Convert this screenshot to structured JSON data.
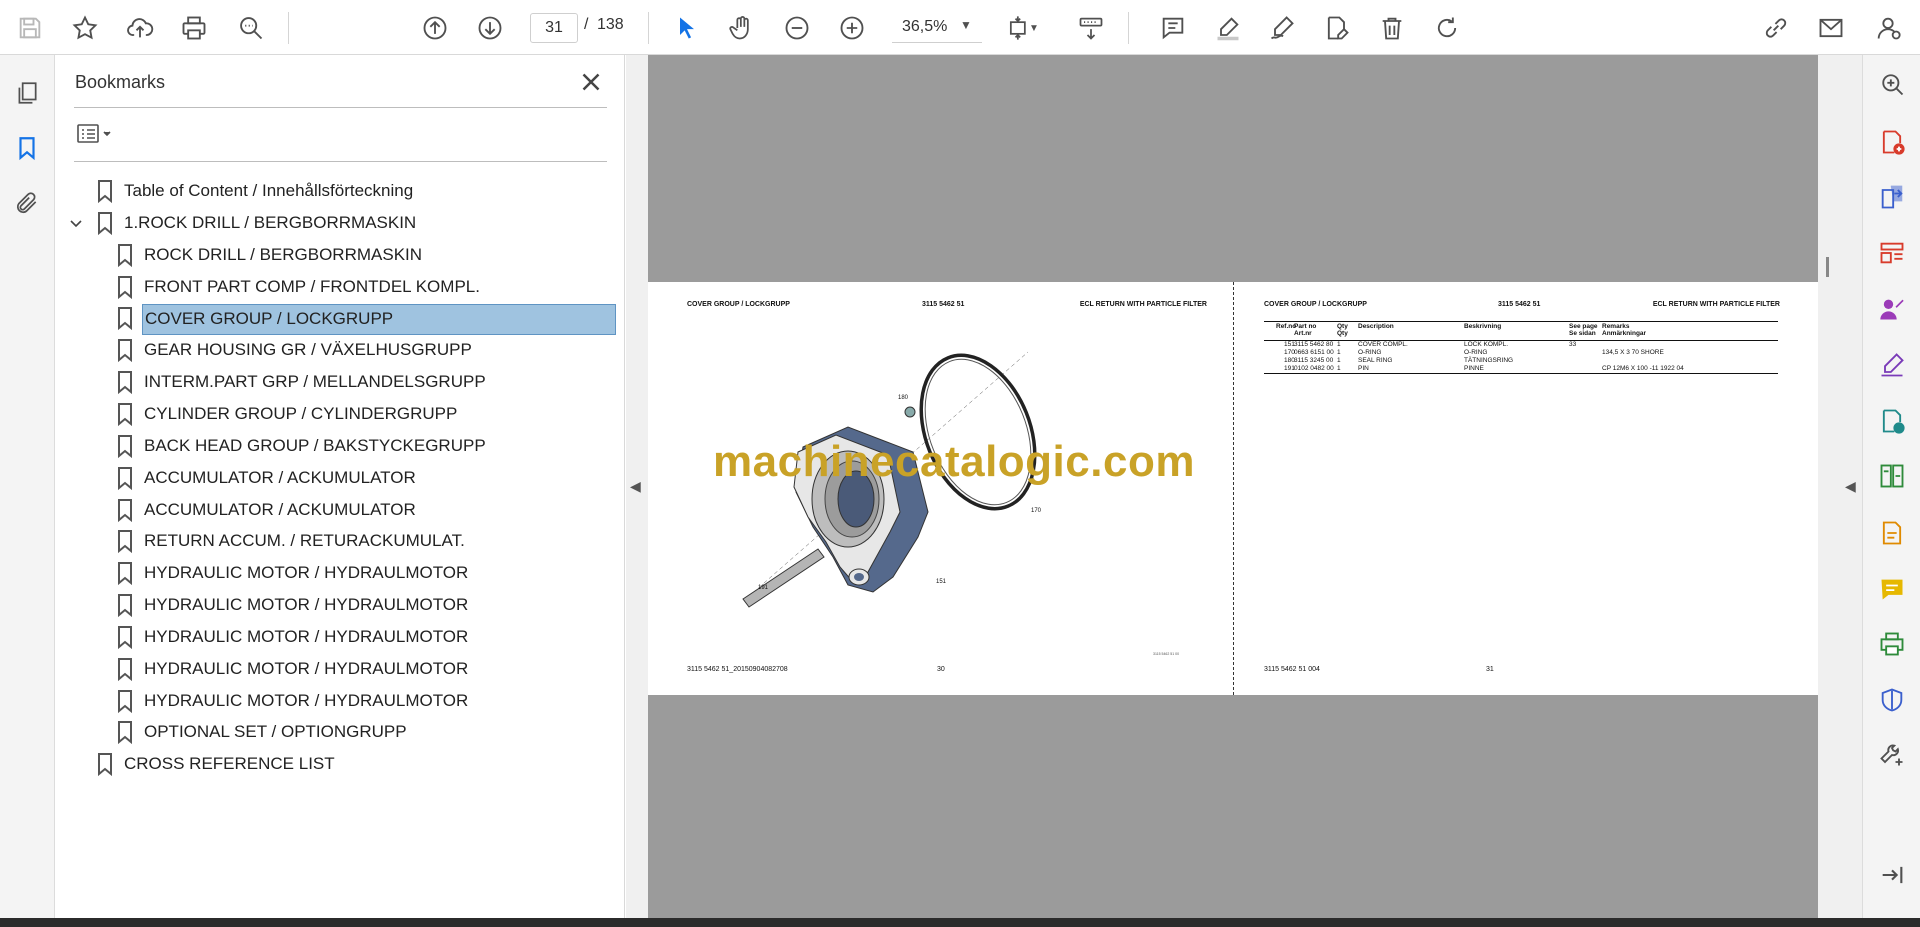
{
  "toolbar": {
    "current_page": "31",
    "page_separator": "/",
    "total_pages": "138",
    "zoom": "36,5%"
  },
  "bookmarks_panel": {
    "title": "Bookmarks",
    "items": [
      {
        "label": "Table of Content / Innehållsförteckning",
        "level": 0,
        "selected": false
      },
      {
        "label": "1.ROCK DRILL / BERGBORRMASKIN",
        "level": 0,
        "expanded": true,
        "selected": false
      },
      {
        "label": "ROCK DRILL / BERGBORRMASKIN",
        "level": 1,
        "selected": false
      },
      {
        "label": "FRONT PART COMP / FRONTDEL KOMPL.",
        "level": 1,
        "selected": false
      },
      {
        "label": "COVER GROUP / LOCKGRUPP",
        "level": 1,
        "selected": true
      },
      {
        "label": "GEAR HOUSING GR / VÄXELHUSGRUPP",
        "level": 1,
        "selected": false
      },
      {
        "label": "INTERM.PART GRP / MELLANDELSGRUPP",
        "level": 1,
        "selected": false
      },
      {
        "label": "CYLINDER GROUP / CYLINDERGRUPP",
        "level": 1,
        "selected": false
      },
      {
        "label": "BACK HEAD GROUP / BAKSTYCKEGRUPP",
        "level": 1,
        "selected": false
      },
      {
        "label": "ACCUMULATOR / ACKUMULATOR",
        "level": 1,
        "selected": false
      },
      {
        "label": "ACCUMULATOR / ACKUMULATOR",
        "level": 1,
        "selected": false
      },
      {
        "label": "RETURN ACCUM. / RETURACKUMULAT.",
        "level": 1,
        "selected": false
      },
      {
        "label": "HYDRAULIC MOTOR / HYDRAULMOTOR",
        "level": 1,
        "selected": false
      },
      {
        "label": "HYDRAULIC MOTOR / HYDRAULMOTOR",
        "level": 1,
        "selected": false
      },
      {
        "label": "HYDRAULIC MOTOR / HYDRAULMOTOR",
        "level": 1,
        "selected": false
      },
      {
        "label": "HYDRAULIC MOTOR / HYDRAULMOTOR",
        "level": 1,
        "selected": false
      },
      {
        "label": "HYDRAULIC MOTOR / HYDRAULMOTOR",
        "level": 1,
        "selected": false
      },
      {
        "label": "OPTIONAL SET / OPTIONGRUPP",
        "level": 1,
        "selected": false
      },
      {
        "label": "CROSS REFERENCE LIST",
        "level": 0,
        "selected": false
      }
    ]
  },
  "document": {
    "left_page": {
      "header_left": "COVER GROUP / LOCKGRUPP",
      "header_mid": "3115 5462 51",
      "header_right": "ECL RETURN WITH PARTICLE FILTER",
      "callouts": [
        "180",
        "170",
        "191",
        "151"
      ],
      "small_ref": "3115 5462 51 00",
      "footer_left": "3115 5462 51_20150904082708",
      "footer_page": "30"
    },
    "right_page": {
      "header_left": "COVER GROUP / LOCKGRUPP",
      "header_mid": "3115 5462 51",
      "header_right": "ECL RETURN WITH PARTICLE FILTER",
      "table": {
        "headers": [
          {
            "a": "Ref.no",
            "b": ""
          },
          {
            "a": "Part no",
            "b": "Art.nr"
          },
          {
            "a": "Qty",
            "b": "Qty"
          },
          {
            "a": "Description",
            "b": ""
          },
          {
            "a": "Beskrivning",
            "b": ""
          },
          {
            "a": "See page",
            "b": "Se sidan"
          },
          {
            "a": "Remarks",
            "b": "Anmärkningar"
          }
        ],
        "rows": [
          [
            "151",
            "3115 5462 80",
            "1",
            "COVER COMPL.",
            "LOCK KOMPL.",
            "33",
            ""
          ],
          [
            "170",
            "0663 6151 00",
            "1",
            "O-RING",
            "O-RING",
            "",
            "134,5 X 3 70 SHORE"
          ],
          [
            "180",
            "3115 3245 00",
            "1",
            "SEAL RING",
            "TÄTNINGSRING",
            "",
            ""
          ],
          [
            "191",
            "0102 0482 00",
            "1",
            "PIN",
            "PINNE",
            "",
            "CP 12M6 X 100 -11 1922 04"
          ]
        ]
      },
      "footer_left": "3115 5462 51 004",
      "footer_page": "31"
    },
    "watermark": "machinecatalogic.com"
  }
}
